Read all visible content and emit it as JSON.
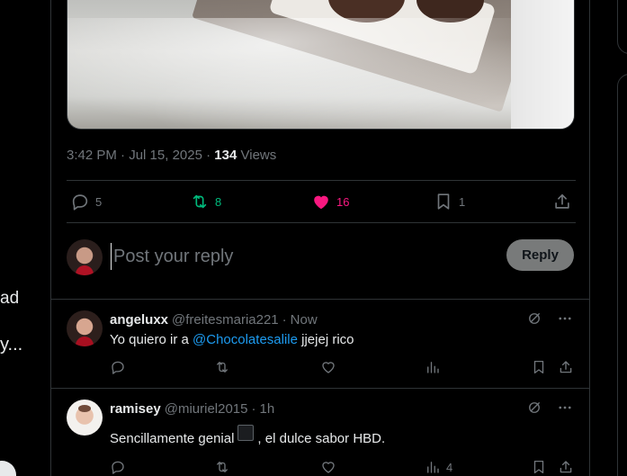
{
  "left_nav": {
    "fragment_1": "ad",
    "fragment_2": "y..."
  },
  "tweet": {
    "time": "3:42 PM",
    "date": "Jul 15, 2025",
    "separator": "·",
    "views_count": "134",
    "views_label": "Views",
    "actions": {
      "replies": "5",
      "reposts": "8",
      "likes": "16",
      "bookmarks": "1"
    }
  },
  "composer": {
    "placeholder": "Post your reply",
    "reply_button": "Reply"
  },
  "replies": [
    {
      "name": "angeluxx",
      "handle": "@freitesmaria221",
      "time": "Now",
      "text_before": "Yo quiero ir a ",
      "mention": "@Chocolatesalile",
      "text_after": " jjejej rico"
    },
    {
      "name": "ramisey",
      "handle": "@miuriel2015",
      "time": "1h",
      "text_before": "Sencillamente genial",
      "text_after": ", el dulce sabor HBD.",
      "views": "4"
    }
  ],
  "colors": {
    "background": "#000000",
    "border": "#2f3336",
    "muted": "#71767b",
    "repost_active": "#00ba7c",
    "like_active": "#f91880",
    "mention": "#1d9bf0"
  }
}
